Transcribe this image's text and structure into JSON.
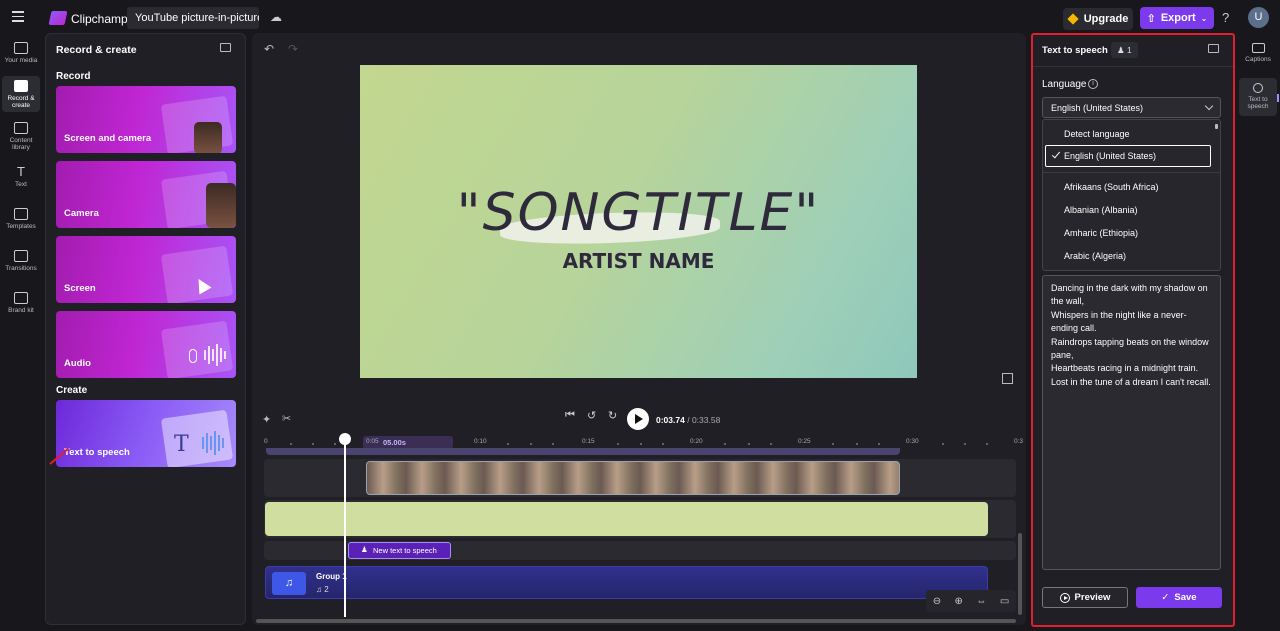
{
  "topbar": {
    "brand": "Clipchamp",
    "project_title": "YouTube picture-in-picture r",
    "upgrade_label": "Upgrade",
    "export_label": "Export",
    "help_label": "?",
    "avatar_initial": "U"
  },
  "left_nav": [
    {
      "label": "Your media"
    },
    {
      "label": "Record & create"
    },
    {
      "label": "Content library"
    },
    {
      "label": "Text"
    },
    {
      "label": "Templates"
    },
    {
      "label": "Transitions"
    },
    {
      "label": "Brand kit"
    }
  ],
  "record_panel": {
    "title": "Record & create",
    "record_section": "Record",
    "create_section": "Create",
    "cards": [
      "Screen and camera",
      "Camera",
      "Screen",
      "Audio"
    ],
    "tts_card": "Text to speech"
  },
  "preview": {
    "song_title": "\"SONGTITLE\"",
    "artist": "ARTIST NAME"
  },
  "playback": {
    "current_time": "0:03.74",
    "total_time": "/ 0:33.58"
  },
  "timeline": {
    "ruler": [
      "0",
      "0:05",
      "0:10",
      "0:15",
      "0:20",
      "0:25",
      "0:30",
      "0:3"
    ],
    "selection_label": "05.00s",
    "tts_clip_label": "New text to speech",
    "group_name": "Group 1",
    "group_count": "2"
  },
  "tts_panel": {
    "title": "Text to speech",
    "count": "1",
    "language_label": "Language",
    "selected_language": "English (United States)",
    "options": {
      "detect": "Detect language",
      "selected": "English (United States)",
      "list": [
        "Afrikaans (South Africa)",
        "Albanian (Albania)",
        "Amharic (Ethiopia)",
        "Arabic (Algeria)"
      ]
    },
    "script": "Dancing in the dark with my shadow on the wall,\nWhispers in the night like a never-ending call.\nRaindrops tapping beats on the window pane,\nHeartbeats racing in a midnight train.\nLost in the tune of a dream I can't recall.",
    "preview_label": "Preview",
    "save_label": "Save"
  },
  "right_nav": [
    {
      "label": "Captions"
    },
    {
      "label": "Text to speech"
    }
  ],
  "colors": {
    "accent": "#7c3aed",
    "highlight_border": "#e0202f",
    "gold": "#f5b800"
  }
}
